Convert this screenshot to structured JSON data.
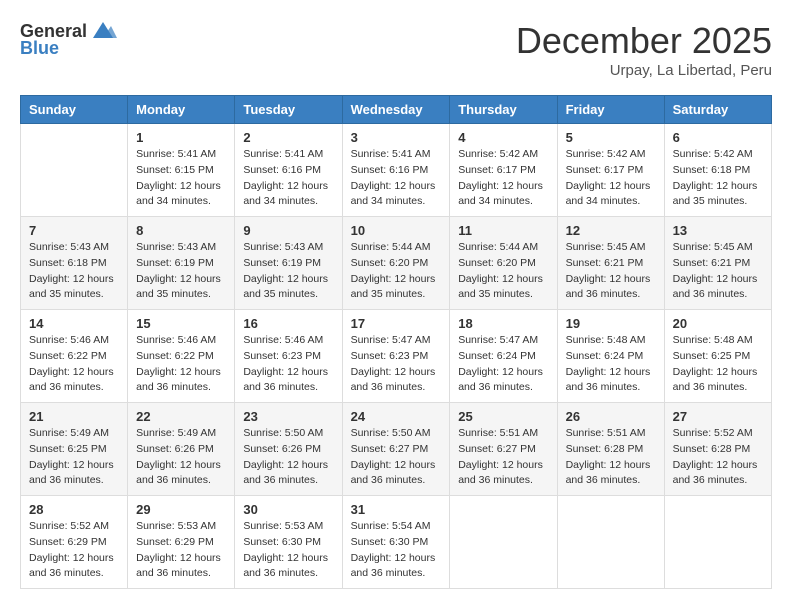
{
  "header": {
    "logo_general": "General",
    "logo_blue": "Blue",
    "month": "December 2025",
    "location": "Urpay, La Libertad, Peru"
  },
  "weekdays": [
    "Sunday",
    "Monday",
    "Tuesday",
    "Wednesday",
    "Thursday",
    "Friday",
    "Saturday"
  ],
  "weeks": [
    {
      "shaded": false,
      "days": [
        {
          "num": "",
          "sunrise": "",
          "sunset": "",
          "daylight": ""
        },
        {
          "num": "1",
          "sunrise": "Sunrise: 5:41 AM",
          "sunset": "Sunset: 6:15 PM",
          "daylight": "Daylight: 12 hours and 34 minutes."
        },
        {
          "num": "2",
          "sunrise": "Sunrise: 5:41 AM",
          "sunset": "Sunset: 6:16 PM",
          "daylight": "Daylight: 12 hours and 34 minutes."
        },
        {
          "num": "3",
          "sunrise": "Sunrise: 5:41 AM",
          "sunset": "Sunset: 6:16 PM",
          "daylight": "Daylight: 12 hours and 34 minutes."
        },
        {
          "num": "4",
          "sunrise": "Sunrise: 5:42 AM",
          "sunset": "Sunset: 6:17 PM",
          "daylight": "Daylight: 12 hours and 34 minutes."
        },
        {
          "num": "5",
          "sunrise": "Sunrise: 5:42 AM",
          "sunset": "Sunset: 6:17 PM",
          "daylight": "Daylight: 12 hours and 34 minutes."
        },
        {
          "num": "6",
          "sunrise": "Sunrise: 5:42 AM",
          "sunset": "Sunset: 6:18 PM",
          "daylight": "Daylight: 12 hours and 35 minutes."
        }
      ]
    },
    {
      "shaded": true,
      "days": [
        {
          "num": "7",
          "sunrise": "Sunrise: 5:43 AM",
          "sunset": "Sunset: 6:18 PM",
          "daylight": "Daylight: 12 hours and 35 minutes."
        },
        {
          "num": "8",
          "sunrise": "Sunrise: 5:43 AM",
          "sunset": "Sunset: 6:19 PM",
          "daylight": "Daylight: 12 hours and 35 minutes."
        },
        {
          "num": "9",
          "sunrise": "Sunrise: 5:43 AM",
          "sunset": "Sunset: 6:19 PM",
          "daylight": "Daylight: 12 hours and 35 minutes."
        },
        {
          "num": "10",
          "sunrise": "Sunrise: 5:44 AM",
          "sunset": "Sunset: 6:20 PM",
          "daylight": "Daylight: 12 hours and 35 minutes."
        },
        {
          "num": "11",
          "sunrise": "Sunrise: 5:44 AM",
          "sunset": "Sunset: 6:20 PM",
          "daylight": "Daylight: 12 hours and 35 minutes."
        },
        {
          "num": "12",
          "sunrise": "Sunrise: 5:45 AM",
          "sunset": "Sunset: 6:21 PM",
          "daylight": "Daylight: 12 hours and 36 minutes."
        },
        {
          "num": "13",
          "sunrise": "Sunrise: 5:45 AM",
          "sunset": "Sunset: 6:21 PM",
          "daylight": "Daylight: 12 hours and 36 minutes."
        }
      ]
    },
    {
      "shaded": false,
      "days": [
        {
          "num": "14",
          "sunrise": "Sunrise: 5:46 AM",
          "sunset": "Sunset: 6:22 PM",
          "daylight": "Daylight: 12 hours and 36 minutes."
        },
        {
          "num": "15",
          "sunrise": "Sunrise: 5:46 AM",
          "sunset": "Sunset: 6:22 PM",
          "daylight": "Daylight: 12 hours and 36 minutes."
        },
        {
          "num": "16",
          "sunrise": "Sunrise: 5:46 AM",
          "sunset": "Sunset: 6:23 PM",
          "daylight": "Daylight: 12 hours and 36 minutes."
        },
        {
          "num": "17",
          "sunrise": "Sunrise: 5:47 AM",
          "sunset": "Sunset: 6:23 PM",
          "daylight": "Daylight: 12 hours and 36 minutes."
        },
        {
          "num": "18",
          "sunrise": "Sunrise: 5:47 AM",
          "sunset": "Sunset: 6:24 PM",
          "daylight": "Daylight: 12 hours and 36 minutes."
        },
        {
          "num": "19",
          "sunrise": "Sunrise: 5:48 AM",
          "sunset": "Sunset: 6:24 PM",
          "daylight": "Daylight: 12 hours and 36 minutes."
        },
        {
          "num": "20",
          "sunrise": "Sunrise: 5:48 AM",
          "sunset": "Sunset: 6:25 PM",
          "daylight": "Daylight: 12 hours and 36 minutes."
        }
      ]
    },
    {
      "shaded": true,
      "days": [
        {
          "num": "21",
          "sunrise": "Sunrise: 5:49 AM",
          "sunset": "Sunset: 6:25 PM",
          "daylight": "Daylight: 12 hours and 36 minutes."
        },
        {
          "num": "22",
          "sunrise": "Sunrise: 5:49 AM",
          "sunset": "Sunset: 6:26 PM",
          "daylight": "Daylight: 12 hours and 36 minutes."
        },
        {
          "num": "23",
          "sunrise": "Sunrise: 5:50 AM",
          "sunset": "Sunset: 6:26 PM",
          "daylight": "Daylight: 12 hours and 36 minutes."
        },
        {
          "num": "24",
          "sunrise": "Sunrise: 5:50 AM",
          "sunset": "Sunset: 6:27 PM",
          "daylight": "Daylight: 12 hours and 36 minutes."
        },
        {
          "num": "25",
          "sunrise": "Sunrise: 5:51 AM",
          "sunset": "Sunset: 6:27 PM",
          "daylight": "Daylight: 12 hours and 36 minutes."
        },
        {
          "num": "26",
          "sunrise": "Sunrise: 5:51 AM",
          "sunset": "Sunset: 6:28 PM",
          "daylight": "Daylight: 12 hours and 36 minutes."
        },
        {
          "num": "27",
          "sunrise": "Sunrise: 5:52 AM",
          "sunset": "Sunset: 6:28 PM",
          "daylight": "Daylight: 12 hours and 36 minutes."
        }
      ]
    },
    {
      "shaded": false,
      "days": [
        {
          "num": "28",
          "sunrise": "Sunrise: 5:52 AM",
          "sunset": "Sunset: 6:29 PM",
          "daylight": "Daylight: 12 hours and 36 minutes."
        },
        {
          "num": "29",
          "sunrise": "Sunrise: 5:53 AM",
          "sunset": "Sunset: 6:29 PM",
          "daylight": "Daylight: 12 hours and 36 minutes."
        },
        {
          "num": "30",
          "sunrise": "Sunrise: 5:53 AM",
          "sunset": "Sunset: 6:30 PM",
          "daylight": "Daylight: 12 hours and 36 minutes."
        },
        {
          "num": "31",
          "sunrise": "Sunrise: 5:54 AM",
          "sunset": "Sunset: 6:30 PM",
          "daylight": "Daylight: 12 hours and 36 minutes."
        },
        {
          "num": "",
          "sunrise": "",
          "sunset": "",
          "daylight": ""
        },
        {
          "num": "",
          "sunrise": "",
          "sunset": "",
          "daylight": ""
        },
        {
          "num": "",
          "sunrise": "",
          "sunset": "",
          "daylight": ""
        }
      ]
    }
  ]
}
